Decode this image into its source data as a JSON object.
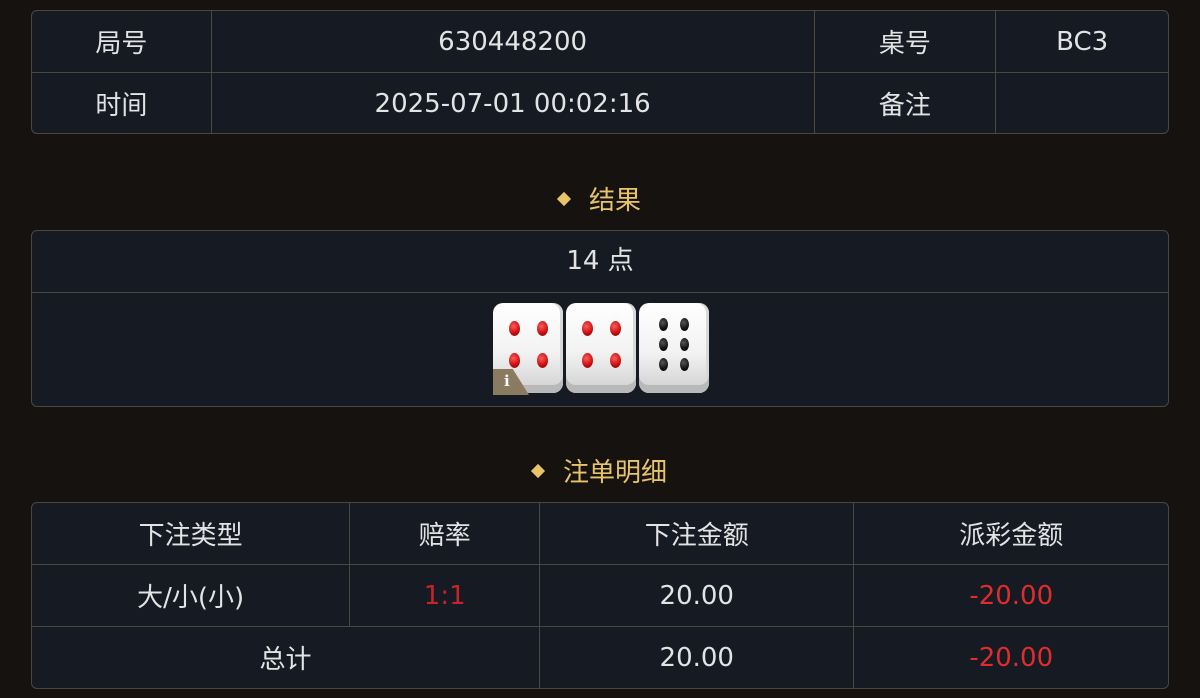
{
  "info": {
    "round_label": "局号",
    "round_value": "630448200",
    "table_label": "桌号",
    "table_value": "BC3",
    "time_label": "时间",
    "time_value": "2025-07-01 00:02:16",
    "note_label": "备注",
    "note_value": ""
  },
  "result": {
    "title": "结果",
    "points": "14 点",
    "dice": [
      4,
      4,
      6
    ],
    "info_icon": "i"
  },
  "bets": {
    "title": "注单明细",
    "headers": [
      "下注类型",
      "赔率",
      "下注金额",
      "派彩金额"
    ],
    "rows": [
      {
        "type": "大/小(小)",
        "odds": "1:1",
        "amount": "20.00",
        "payout": "-20.00"
      }
    ],
    "total": {
      "label": "总计",
      "amount": "20.00",
      "payout": "-20.00"
    }
  },
  "colors": {
    "accent": "#e7c36a",
    "negative": "#e02c2c",
    "background": "#16120f",
    "panel": "#151a23"
  }
}
